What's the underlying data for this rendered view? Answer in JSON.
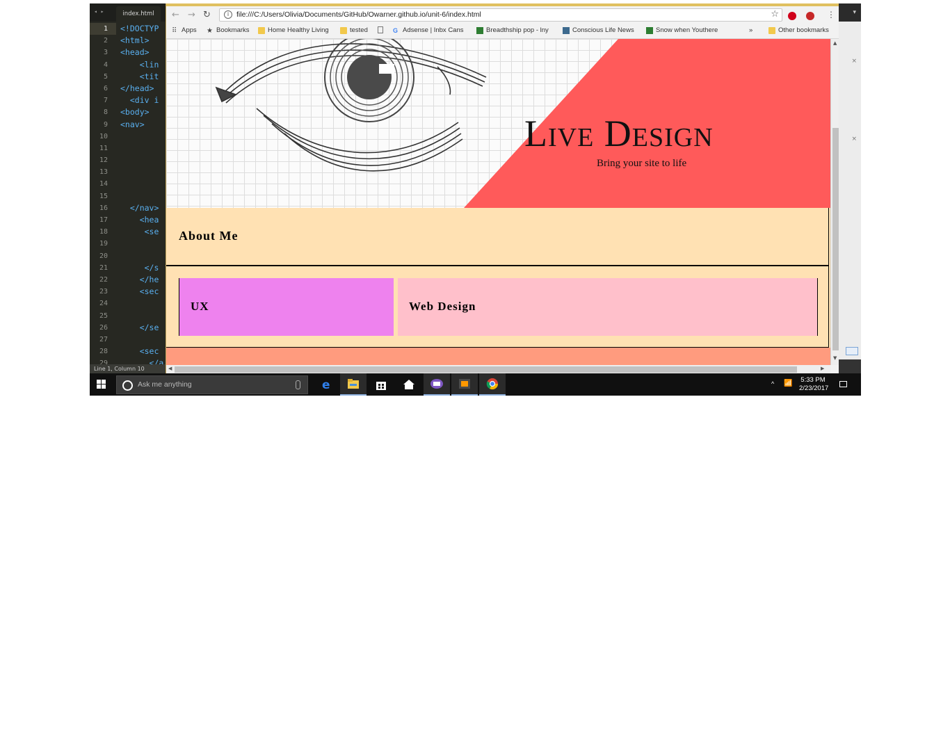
{
  "editor": {
    "tab_label": "index.html",
    "tab_arrows": "◂ ▸",
    "line_numbers": [
      "1",
      "2",
      "3",
      "4",
      "5",
      "6",
      "7",
      "8",
      "9",
      "10",
      "11",
      "12",
      "13",
      "14",
      "15",
      "16",
      "17",
      "18",
      "19",
      "20",
      "21",
      "22",
      "23",
      "24",
      "25",
      "26",
      "27",
      "28",
      "29"
    ],
    "code_lines": [
      "<!DOCTYP",
      "<html>",
      "<head>",
      "    <lin",
      "    <tit",
      "</head>",
      "  <div i",
      "<body>",
      "<nav>",
      "",
      "",
      "",
      "",
      "",
      "",
      "  </nav>",
      "    <hea",
      "     <se",
      "",
      "",
      "     </s",
      "    </he",
      "    <sec",
      "",
      "",
      "    </se",
      "",
      "    <sec",
      "      </a"
    ],
    "status_text": "Line 1, Column 10"
  },
  "browser": {
    "url": "file:///C:/Users/Olivia/Documents/GitHub/Owarner.github.io/unit-6/index.html",
    "bookmarks": [
      {
        "label": "Apps",
        "icon": "apps-grid-icon"
      },
      {
        "label": "Bookmarks",
        "icon": "star-icon"
      },
      {
        "label": "Home Healthy Living",
        "icon": "folder-icon"
      },
      {
        "label": "tested",
        "icon": "folder-icon"
      },
      {
        "label": "",
        "icon": "page-icon"
      },
      {
        "label": "Adsense | Inbx Cans",
        "icon": "google-icon"
      },
      {
        "label": "Breadthship pop - lny",
        "icon": "green-square-icon"
      },
      {
        "label": "Conscious Life News",
        "icon": "image-icon"
      },
      {
        "label": "Snow when Youthere",
        "icon": "green-square-icon"
      },
      {
        "label": "»",
        "icon": ""
      },
      {
        "label": "Other bookmarks",
        "icon": "folder-icon"
      }
    ]
  },
  "page": {
    "hero_title": "Live Design",
    "hero_subtitle": "Bring your site to life",
    "about_title": "About Me",
    "card_ux": "UX",
    "card_web": "Web Design",
    "colors": {
      "background": "#ffe1b3",
      "hero_accent": "#ff5a5a",
      "card_ux": "#ee82ee",
      "card_web": "#ffc0cb",
      "footer": "#ff9b7e"
    }
  },
  "taskbar": {
    "search_placeholder": "Ask me anything",
    "time": "5:33 PM",
    "date": "2/23/2017",
    "pinned": [
      "edge-icon",
      "file-explorer-icon",
      "store-icon",
      "home-icon",
      "visual-studio-icon",
      "sublime-text-icon",
      "chrome-icon"
    ]
  }
}
